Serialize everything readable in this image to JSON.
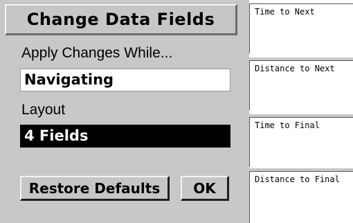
{
  "menu": {
    "title": "Change Data Fields",
    "apply_label": "Apply Changes While...",
    "apply_value": "Navigating",
    "layout_label": "Layout",
    "layout_value": "4 Fields",
    "restore_button": "Restore Defaults",
    "ok_button": "OK"
  },
  "data_fields": [
    {
      "label": "Time to Next"
    },
    {
      "label": "Distance to Next"
    },
    {
      "label": "Time to Final"
    },
    {
      "label": "Distance to Final"
    }
  ],
  "colors": {
    "background": "#c8c8c8",
    "selected_field_bg": "#000000",
    "selected_field_text": "#ffffff",
    "field_bg": "#ffffff"
  }
}
